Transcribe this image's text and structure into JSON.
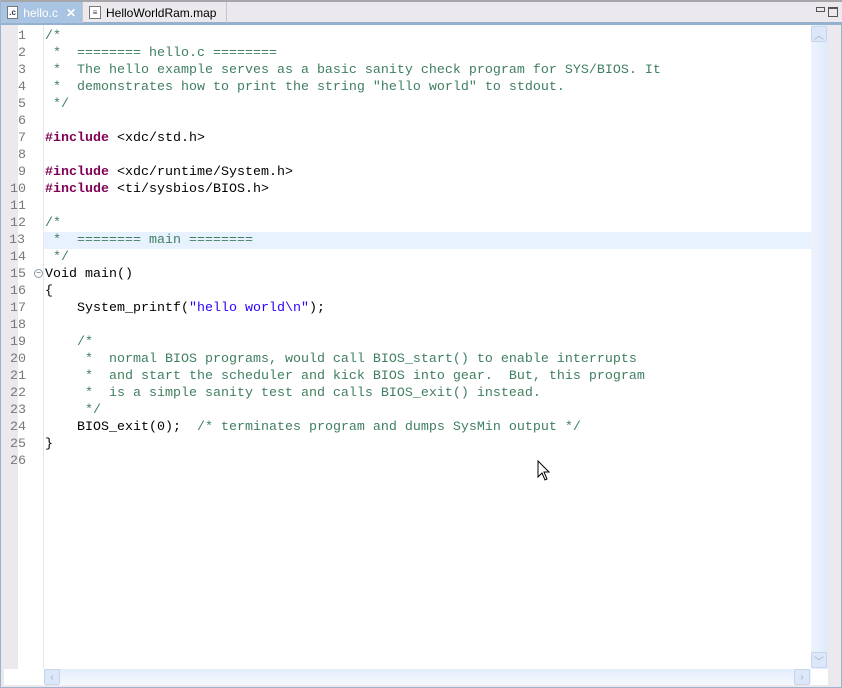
{
  "tabs": [
    {
      "label": "hello.c",
      "icon": "c-file-icon",
      "active": true
    },
    {
      "label": "HelloWorldRam.map",
      "icon": "text-file-icon",
      "active": false
    }
  ],
  "colors": {
    "comment": "#3f7f5f",
    "keyword": "#7f0055",
    "string": "#2a00ff",
    "current_line": "#e8f2fe"
  },
  "current_line": 13,
  "lines": [
    [
      {
        "t": "/*",
        "c": "c"
      }
    ],
    [
      {
        "t": " *  ======== hello.c ========",
        "c": "c"
      }
    ],
    [
      {
        "t": " *  The hello example serves as a basic sanity check program for SYS/BIOS. It",
        "c": "c"
      }
    ],
    [
      {
        "t": " *  demonstrates how to print the string \"hello world\" to stdout.",
        "c": "c"
      }
    ],
    [
      {
        "t": " */",
        "c": "c"
      }
    ],
    [],
    [
      {
        "t": "#include",
        "c": "k"
      },
      {
        "t": " <xdc/std.h>"
      }
    ],
    [],
    [
      {
        "t": "#include",
        "c": "k"
      },
      {
        "t": " <xdc/runtime/System.h>"
      }
    ],
    [
      {
        "t": "#include",
        "c": "k"
      },
      {
        "t": " <ti/sysbios/BIOS.h>"
      }
    ],
    [],
    [
      {
        "t": "/*",
        "c": "c"
      }
    ],
    [
      {
        "t": " *  ======== main ========",
        "c": "c"
      }
    ],
    [
      {
        "t": " */",
        "c": "c"
      }
    ],
    [
      {
        "t": "Void main()"
      }
    ],
    [
      {
        "t": "{"
      }
    ],
    [
      {
        "t": "    System_printf("
      },
      {
        "t": "\"hello world\\n\"",
        "c": "s"
      },
      {
        "t": ");"
      }
    ],
    [],
    [
      {
        "t": "    /*",
        "c": "c"
      }
    ],
    [
      {
        "t": "     *  normal BIOS programs, would call BIOS_start() to enable interrupts",
        "c": "c"
      }
    ],
    [
      {
        "t": "     *  and start the scheduler and kick BIOS into gear.  But, this program",
        "c": "c"
      }
    ],
    [
      {
        "t": "     *  is a simple sanity test and calls BIOS_exit() instead.",
        "c": "c"
      }
    ],
    [
      {
        "t": "     */",
        "c": "c"
      }
    ],
    [
      {
        "t": "    BIOS_exit(0);  "
      },
      {
        "t": "/* terminates program and dumps SysMin output */",
        "c": "c"
      }
    ],
    [
      {
        "t": "}"
      }
    ],
    []
  ],
  "fold_lines": [
    15
  ]
}
